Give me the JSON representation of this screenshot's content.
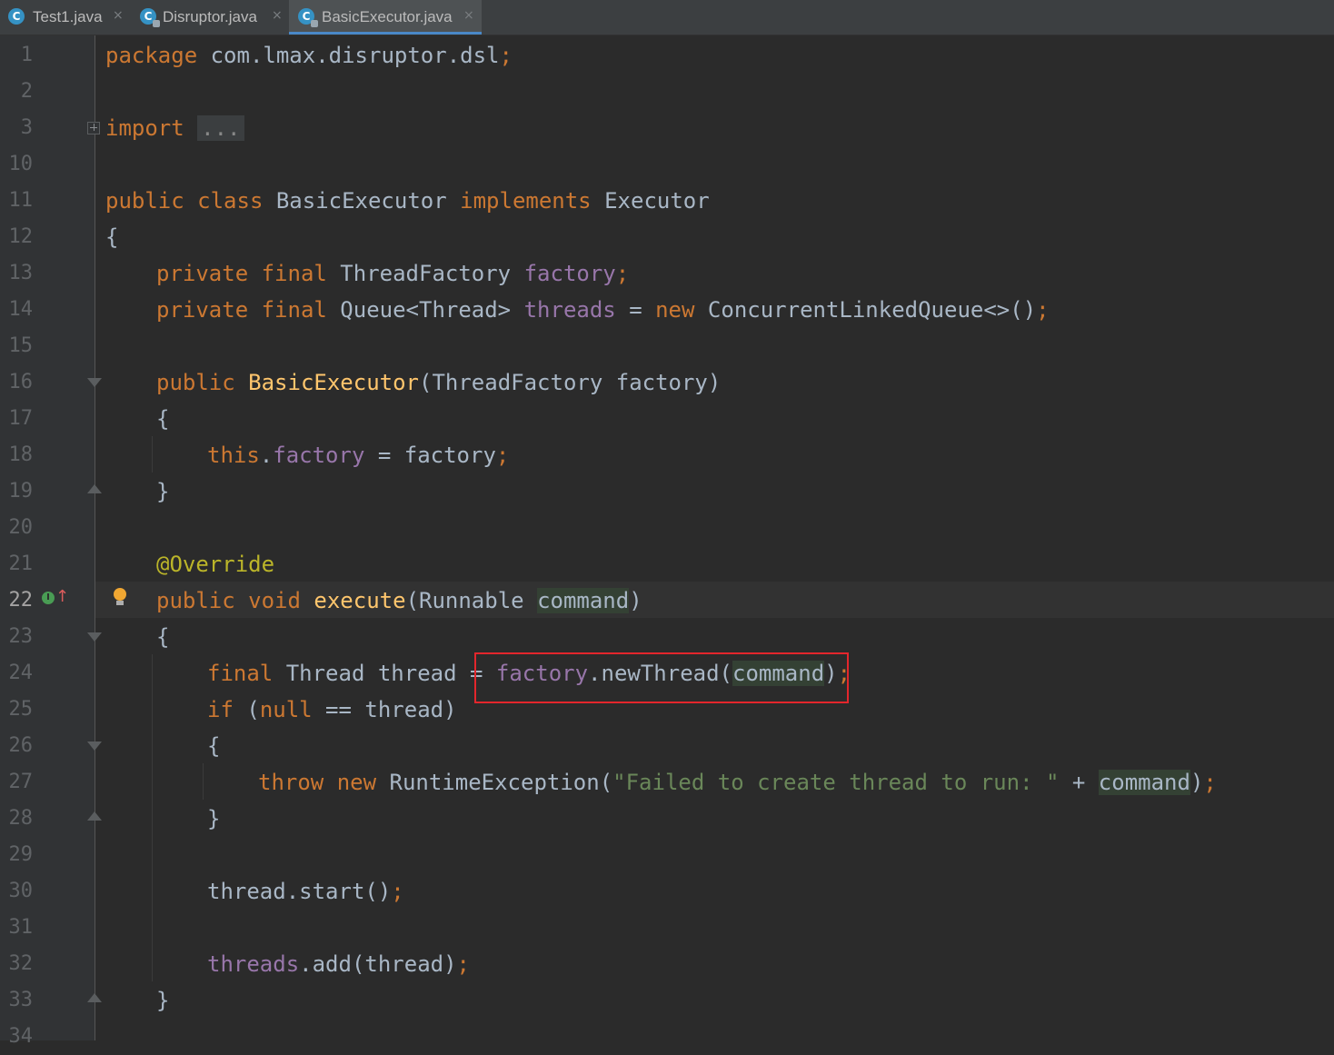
{
  "tabs": [
    {
      "label": "Test1.java",
      "icon": "java-class-icon",
      "active": false
    },
    {
      "label": "Disruptor.java",
      "icon": "java-class-locked-icon",
      "active": false
    },
    {
      "label": "BasicExecutor.java",
      "icon": "java-class-locked-icon",
      "active": true
    }
  ],
  "tab_close_glyph": "×",
  "tab_icon_letter": "C",
  "line_numbers": [
    "1",
    "2",
    "3",
    "10",
    "11",
    "12",
    "13",
    "14",
    "15",
    "16",
    "17",
    "18",
    "19",
    "20",
    "21",
    "22",
    "23",
    "24",
    "25",
    "26",
    "27",
    "28",
    "29",
    "30",
    "31",
    "32",
    "33",
    "34"
  ],
  "current_line": "22",
  "code": {
    "l1_kw": "package",
    "l1_rest": " com.lmax.disruptor.dsl",
    "l1_semi": ";",
    "l3_kw": "import",
    "l3_fold": "...",
    "l11_a": "public class",
    "l11_b": " BasicExecutor ",
    "l11_c": "implements",
    "l11_d": " Executor",
    "l12": "{",
    "l13_kw": "private final",
    "l13_type": " ThreadFactory ",
    "l13_field": "factory",
    "l13_semi": ";",
    "l14_kw": "private final",
    "l14_type": " Queue<Thread> ",
    "l14_field": "threads",
    "l14_eq": " = ",
    "l14_new": "new",
    "l14_rest": " ConcurrentLinkedQueue<>()",
    "l14_semi": ";",
    "l16_kw": "public",
    "l16_fn": "BasicExecutor",
    "l16_rest": "(ThreadFactory factory)",
    "l17": "{",
    "l18_this": "this",
    "l18_dot": ".",
    "l18_field": "factory",
    "l18_rest": " = factory",
    "l18_semi": ";",
    "l19": "}",
    "l21_ann": "@Override",
    "l22_kw": "public void",
    "l22_fn": "execute",
    "l22_open": "(Runnable ",
    "l22_param": "command",
    "l22_close": ")",
    "l23": "{",
    "l24_kw": "final",
    "l24_mid": " Thread thread = ",
    "l24_field": "factory",
    "l24_call": ".newThread(",
    "l24_param": "command",
    "l24_close": ")",
    "l24_semi": ";",
    "l25_kw": "if",
    "l25_open": " (",
    "l25_null": "null",
    "l25_rest": " == thread)",
    "l26": "{",
    "l27_throw": "throw",
    "l27_new": "new",
    "l27_type": " RuntimeException(",
    "l27_str": "\"Failed to create thread to run: \"",
    "l27_plus": " + ",
    "l27_param": "command",
    "l27_close": ")",
    "l27_semi": ";",
    "l28": "}",
    "l30": "thread.start()",
    "l30_semi": ";",
    "l32_field": "threads",
    "l32_rest": ".add(thread)",
    "l32_semi": ";",
    "l33": "}"
  },
  "colors": {
    "background": "#2b2b2b",
    "keyword": "#cc7832",
    "field": "#9876aa",
    "function": "#ffc66d",
    "annotation": "#bbb529",
    "string": "#6a8759",
    "text": "#a9b7c6",
    "highlight_box": "#e3262c"
  }
}
